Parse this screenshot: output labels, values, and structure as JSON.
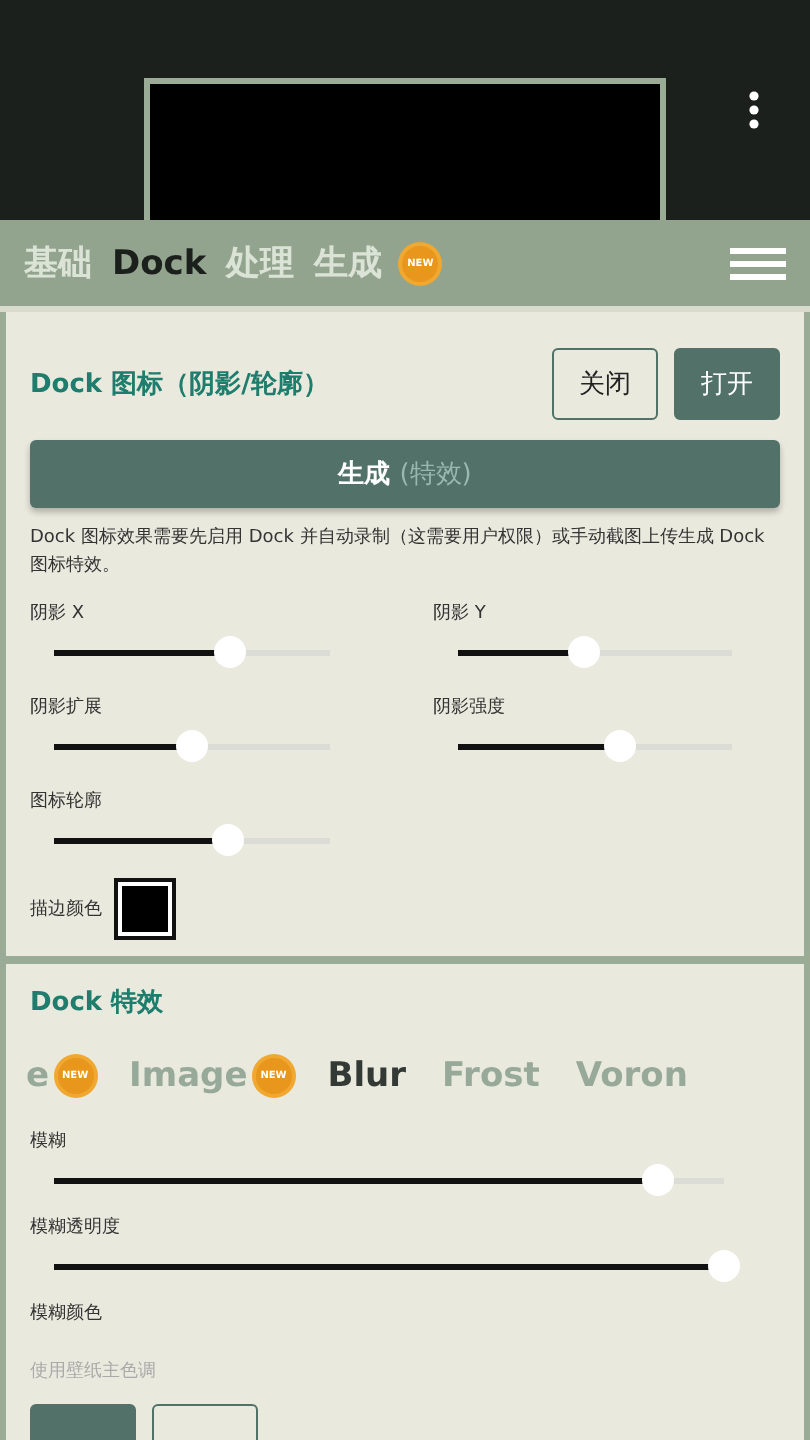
{
  "tabs": [
    {
      "label": "基础",
      "selected": false
    },
    {
      "label": "Dock",
      "selected": true
    },
    {
      "label": "处理",
      "selected": false
    },
    {
      "label": "生成",
      "selected": false,
      "badge": "NEW"
    }
  ],
  "icon_card": {
    "title": "Dock 图标（阴影/轮廓）",
    "buttons": [
      {
        "label": "关闭",
        "selected": false
      },
      {
        "label": "打开",
        "selected": true
      }
    ],
    "generate": {
      "label": "生成",
      "hint": "(特效)"
    },
    "note": "Dock 图标效果需要先启用 Dock 并自动录制（这需要用户权限）或手动截图上传生成 Dock 图标特效。",
    "sliders": [
      {
        "label": "阴影 X",
        "level": 0.64
      },
      {
        "label": "阴影 Y",
        "level": 0.46
      },
      {
        "label": "阴影扩展",
        "level": 0.5
      },
      {
        "label": "阴影强度",
        "level": 0.59
      },
      {
        "label": "图标轮廓",
        "level": 0.63
      }
    ],
    "stroke_color": {
      "label": "描边颜色",
      "color": "#000000"
    }
  },
  "effects_card": {
    "title": "Dock 特效",
    "effect_tabs": [
      {
        "label": "e",
        "selected": false,
        "badge": "NEW"
      },
      {
        "label": "Image",
        "selected": false,
        "badge": "NEW"
      },
      {
        "label": "Blur",
        "selected": true
      },
      {
        "label": "Frost",
        "selected": false
      },
      {
        "label": "Voron",
        "selected": false
      }
    ],
    "sliders": [
      {
        "label": "模糊",
        "level": 0.9
      },
      {
        "label": "模糊透明度",
        "level": 1.0
      }
    ],
    "blur_color": {
      "label": "模糊颜色",
      "hint": "使用壁纸主色调"
    },
    "buttons": [
      {
        "selected": true
      },
      {
        "selected": false
      }
    ]
  }
}
